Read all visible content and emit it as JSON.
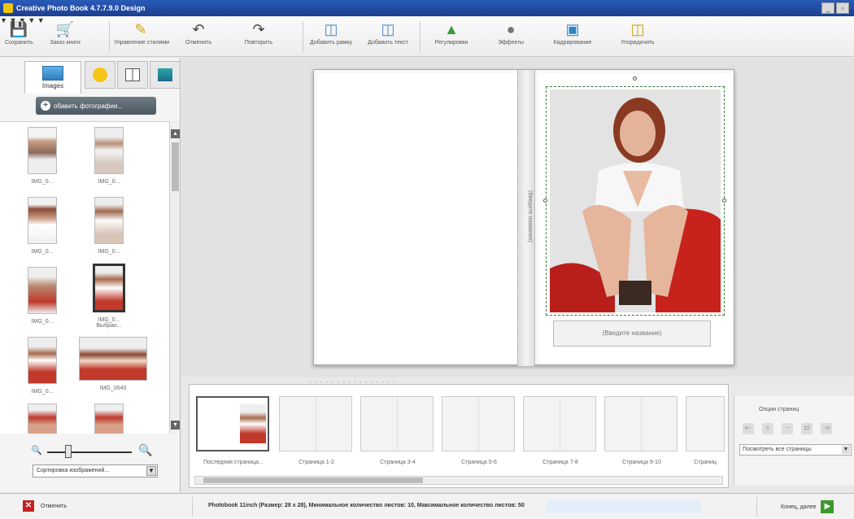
{
  "window": {
    "title": "Creative Photo Book 4.7.7.9.0 Design",
    "controls": [
      "_",
      "▫"
    ]
  },
  "toolbar": {
    "buttons": [
      {
        "label": "Сохранить",
        "icon": "save-icon"
      },
      {
        "label": "Заказ книги",
        "icon": "cart-icon"
      },
      {
        "label": "Управление стилями",
        "icon": "pen-icon"
      },
      {
        "label": "Отменить",
        "icon": "undo-icon"
      },
      {
        "label": "Повторить",
        "icon": "redo-icon"
      },
      {
        "label": "Добавить рамку",
        "icon": "add-frame-icon"
      },
      {
        "label": "Добавить текст",
        "icon": "add-text-icon"
      },
      {
        "label": "Регулировки",
        "icon": "adjust-icon"
      },
      {
        "label": "Эффекты",
        "icon": "effects-icon"
      },
      {
        "label": "Кадрирование",
        "icon": "crop-icon"
      },
      {
        "label": "Упорядочить",
        "icon": "arrange-icon"
      }
    ]
  },
  "left_panel": {
    "tab_images_label": "Images",
    "add_photos_label": "обавить фотографии...",
    "sort_label": "Сортировка изображений...",
    "thumbnails": [
      {
        "name": "IMG_0..."
      },
      {
        "name": "IMG_0..."
      },
      {
        "name": "IMG_0..."
      },
      {
        "name": "IMG_0..."
      },
      {
        "name": "IMG_0..."
      },
      {
        "name": "IMG_0... Выбран..."
      },
      {
        "name": "IMG_0..."
      },
      {
        "name": "IMG_0540"
      },
      {
        "name": ""
      },
      {
        "name": ""
      }
    ]
  },
  "canvas": {
    "spine_text": "(Введите название)",
    "caption_text": "(Введите название)"
  },
  "strip": {
    "dots": "· · · · · · · · · · · · · · · ·",
    "pages": [
      {
        "label": "Последняя страница..."
      },
      {
        "label": "Страница 1-2"
      },
      {
        "label": "Страница 3-4"
      },
      {
        "label": "Страница 5-6"
      },
      {
        "label": "Страница 7-8"
      },
      {
        "label": "Страница 9-10"
      },
      {
        "label": "Страниц"
      }
    ]
  },
  "page_options": {
    "title": "Опции страниц",
    "view_all": "Посмотреть все страницы"
  },
  "status": {
    "cancel_label": "Отменить",
    "info_text": "Photobook 11inch (Размер: 28 x 28), Минимальное количество листов: 10, Максимальное количество листов: 50",
    "next_label": "Конец, далее",
    "cancel_icon": "close-icon",
    "next_icon": "arrow-right-icon"
  }
}
